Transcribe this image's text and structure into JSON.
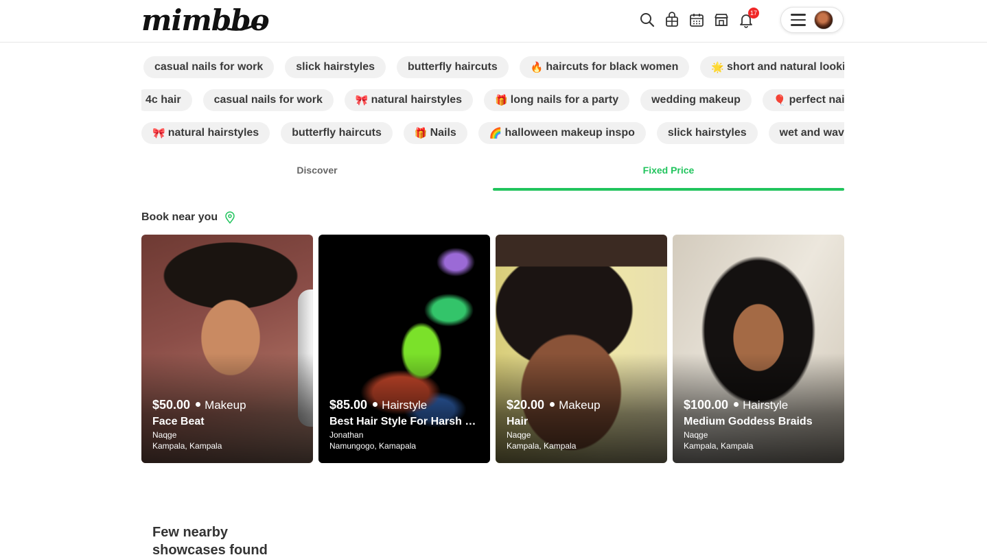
{
  "header": {
    "logo": "mimbbo",
    "notification_count": "17",
    "icons": [
      "search-icon",
      "gift-shop-icon",
      "calendar-icon",
      "store-icon",
      "bell-icon",
      "menu-icon"
    ]
  },
  "chip_rows": [
    [
      {
        "emoji": "",
        "label": "casual nails for work"
      },
      {
        "emoji": "",
        "label": "slick hairstyles"
      },
      {
        "emoji": "",
        "label": "butterfly haircuts"
      },
      {
        "emoji": "🔥",
        "label": "haircuts for black women"
      },
      {
        "emoji": "🌟",
        "label": "short and natural looking"
      }
    ],
    [
      {
        "emoji": "",
        "label": "4c hair"
      },
      {
        "emoji": "",
        "label": "casual nails for work"
      },
      {
        "emoji": "🎀",
        "label": "natural hairstyles"
      },
      {
        "emoji": "🎁",
        "label": "long nails for a party"
      },
      {
        "emoji": "",
        "label": "wedding makeup"
      },
      {
        "emoji": "🎈",
        "label": "perfect nails"
      }
    ],
    [
      {
        "emoji": "🎀",
        "label": "natural hairstyles"
      },
      {
        "emoji": "",
        "label": "butterfly haircuts"
      },
      {
        "emoji": "🎁",
        "label": "Nails"
      },
      {
        "emoji": "🌈",
        "label": "halloween makeup inspo"
      },
      {
        "emoji": "",
        "label": "slick hairstyles"
      },
      {
        "emoji": "",
        "label": "wet and wavy"
      }
    ]
  ],
  "tabs": [
    {
      "label": "Discover",
      "active": false
    },
    {
      "label": "Fixed Price",
      "active": true
    }
  ],
  "section": {
    "title": "Book near you"
  },
  "cards": [
    {
      "price": "$50.00",
      "category": "Makeup",
      "title": "Face Beat",
      "provider": "Naqge",
      "location": "Kampala, Kampala"
    },
    {
      "price": "$85.00",
      "category": "Hairstyle",
      "title": "Best Hair Style For Harsh Winter",
      "provider": "Jonathan",
      "location": "Namungogo, Kamapala"
    },
    {
      "price": "$20.00",
      "category": "Makeup",
      "title": "Hair",
      "provider": "Naqge",
      "location": "Kampala, Kampala"
    },
    {
      "price": "$100.00",
      "category": "Hairstyle",
      "title": "Medium Goddess Braids",
      "provider": "Naqge",
      "location": "Kampala, Kampala"
    }
  ],
  "footer_note": {
    "text": "Few nearby showcases found"
  },
  "colors": {
    "accent": "#21c45d",
    "badge": "#f02828",
    "chip_bg": "#f1f1f1"
  }
}
